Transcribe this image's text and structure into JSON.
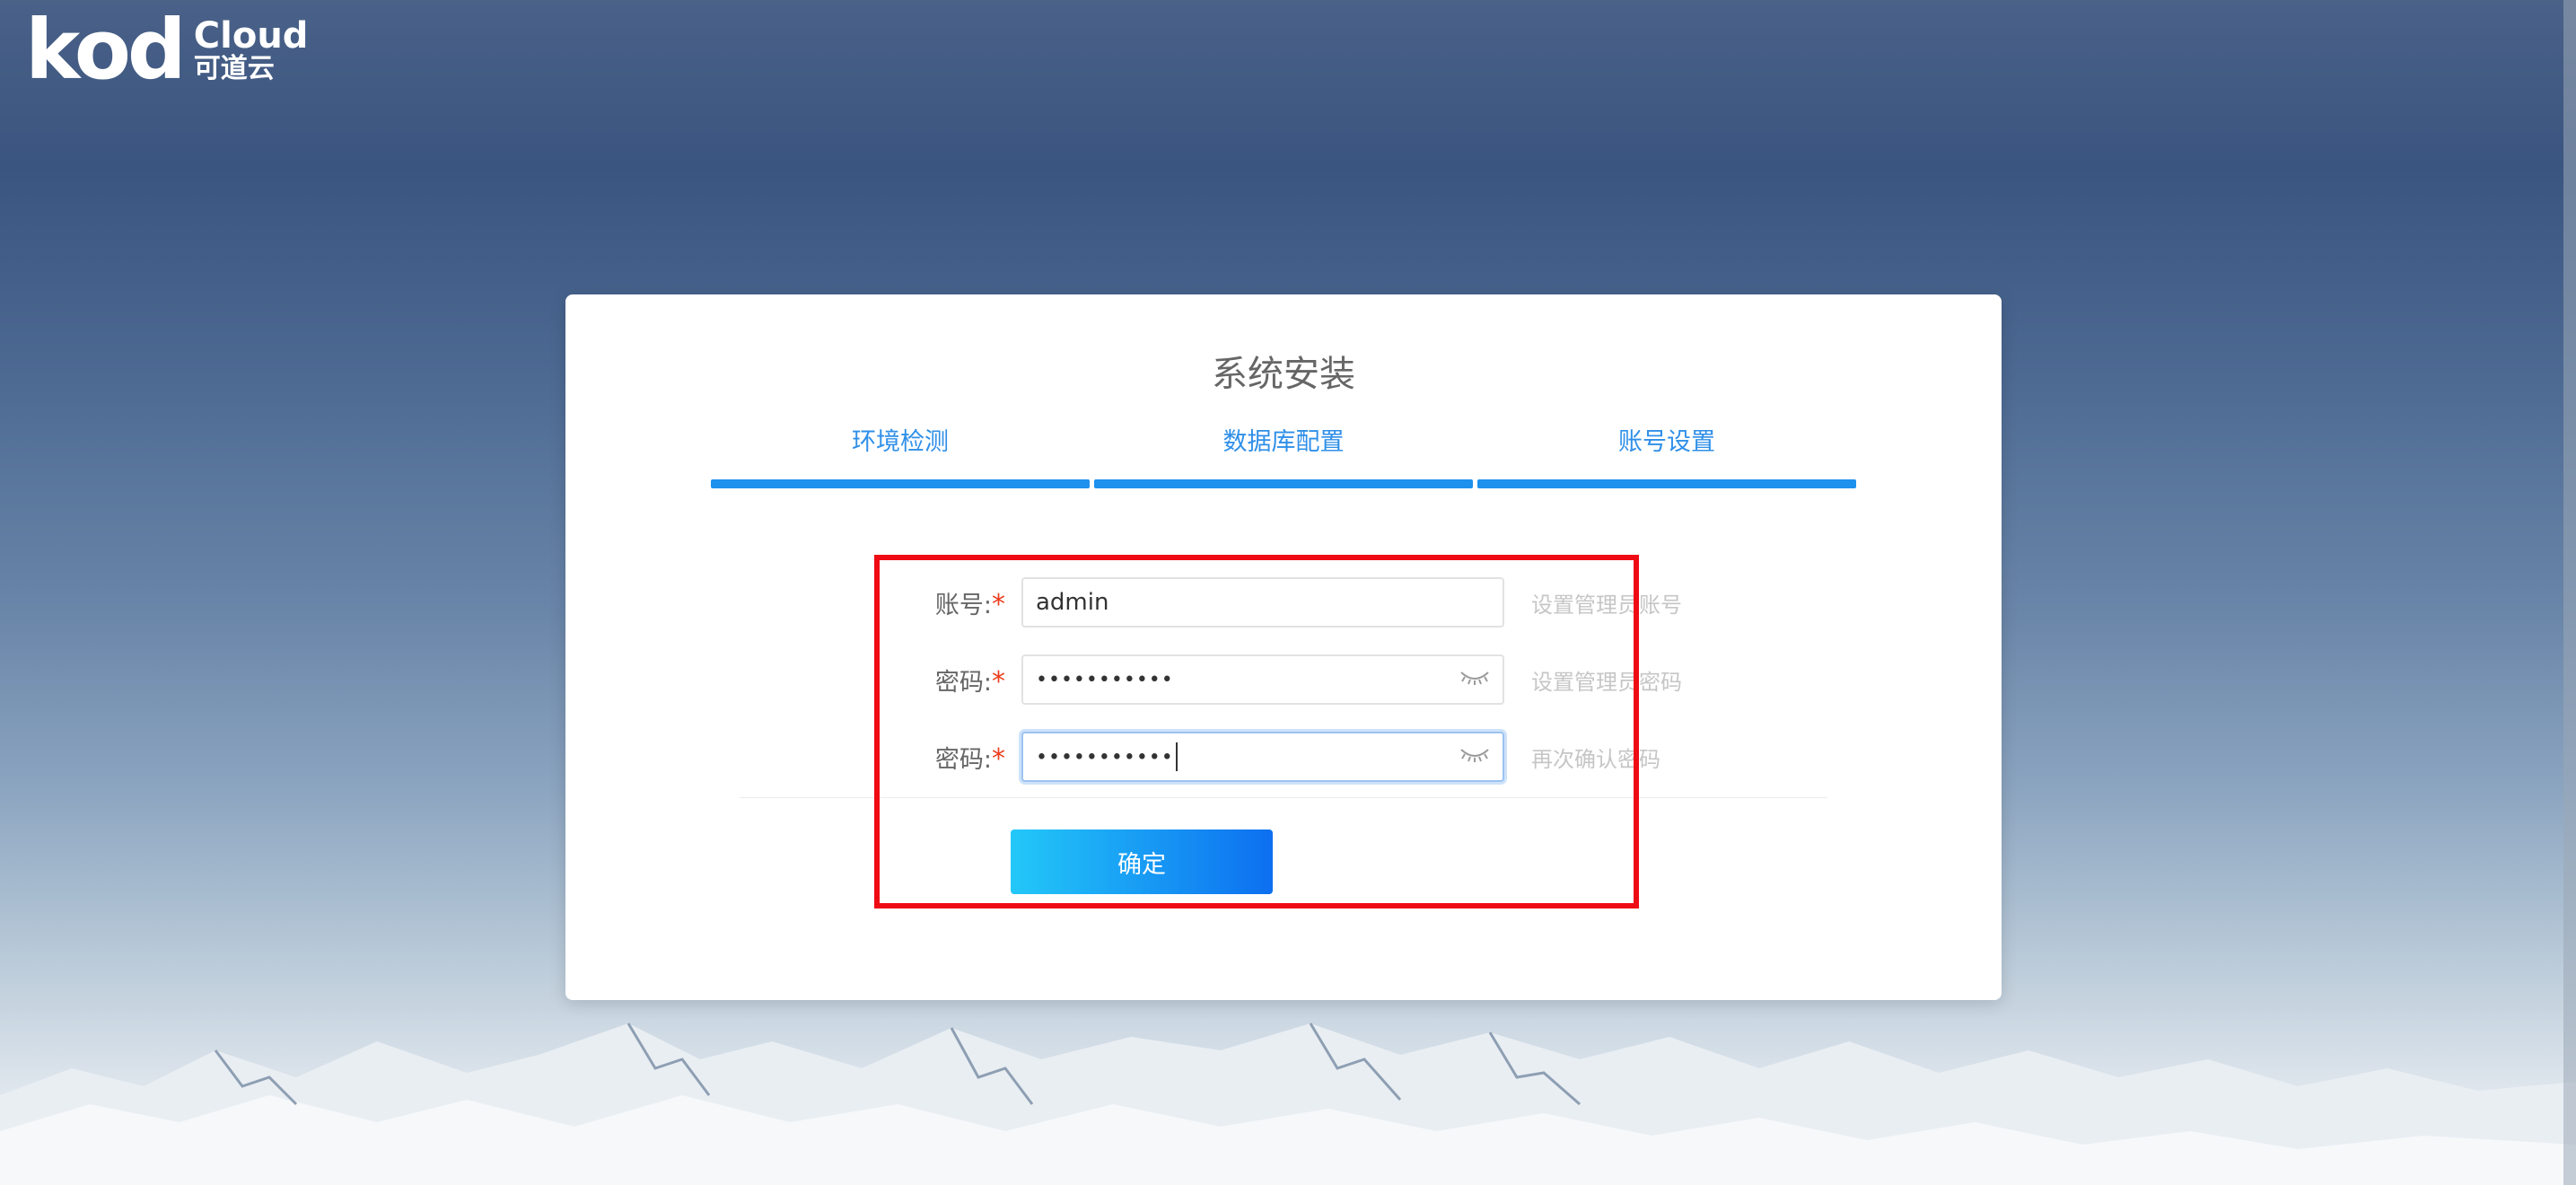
{
  "logo": {
    "brand": "kod",
    "cloud": "Cloud",
    "cn": "可道云"
  },
  "install": {
    "title": "系统安装",
    "steps": [
      {
        "label": "环境检测"
      },
      {
        "label": "数据库配置"
      },
      {
        "label": "账号设置"
      }
    ]
  },
  "form": {
    "account": {
      "label": "账号:",
      "required": "*",
      "value": "admin",
      "hint": "设置管理员账号"
    },
    "password": {
      "label": "密码:",
      "required": "*",
      "value": "•••••••••••",
      "hint": "设置管理员密码"
    },
    "confirm": {
      "label": "密码:",
      "required": "*",
      "value": "•••••••••••",
      "hint": "再次确认密码"
    },
    "submit_label": "确定",
    "eye_icon": "eye-closed-icon"
  },
  "colors": {
    "accent": "#1e90ee",
    "required": "#ee3b1b",
    "highlight": "#ee0b14"
  }
}
